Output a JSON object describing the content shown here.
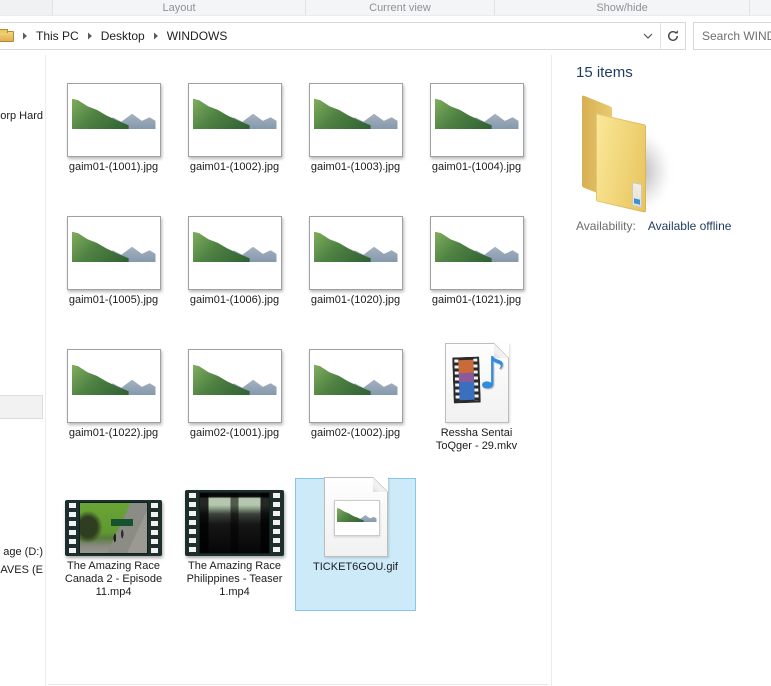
{
  "ribbon": {
    "groups": [
      {
        "label": "Layout"
      },
      {
        "label": "Current view"
      },
      {
        "label": "Show/hide"
      }
    ]
  },
  "address_bar": {
    "breadcrumb": [
      {
        "label": "This PC"
      },
      {
        "label": "Desktop"
      },
      {
        "label": "WINDOWS"
      }
    ],
    "search_placeholder": "Search WIND"
  },
  "sidebar": {
    "items": [
      {
        "label": "orp Hard"
      },
      {
        "label": "age (D:)"
      },
      {
        "label": "SAVES (E"
      }
    ]
  },
  "files": [
    {
      "name": "gaim01-(1001).jpg",
      "icon": "image",
      "selected": false
    },
    {
      "name": "gaim01-(1002).jpg",
      "icon": "image",
      "selected": false
    },
    {
      "name": "gaim01-(1003).jpg",
      "icon": "image",
      "selected": false
    },
    {
      "name": "gaim01-(1004).jpg",
      "icon": "image",
      "selected": false
    },
    {
      "name": "gaim01-(1005).jpg",
      "icon": "image",
      "selected": false
    },
    {
      "name": "gaim01-(1006).jpg",
      "icon": "image",
      "selected": false
    },
    {
      "name": "gaim01-(1020).jpg",
      "icon": "image",
      "selected": false
    },
    {
      "name": "gaim01-(1021).jpg",
      "icon": "image",
      "selected": false
    },
    {
      "name": "gaim01-(1022).jpg",
      "icon": "image",
      "selected": false
    },
    {
      "name": "gaim02-(1001).jpg",
      "icon": "image",
      "selected": false
    },
    {
      "name": "gaim02-(1002).jpg",
      "icon": "image",
      "selected": false
    },
    {
      "name": "Ressha Sentai ToQger - 29.mkv",
      "icon": "media-note",
      "selected": false
    },
    {
      "name": "The Amazing Race Canada 2 - Episode 11.mp4",
      "icon": "film-green",
      "selected": false
    },
    {
      "name": "The Amazing Race Philippines - Teaser 1.mp4",
      "icon": "film-dark",
      "selected": false
    },
    {
      "name": "TICKET6GOU.gif",
      "icon": "gif-page",
      "selected": true
    }
  ],
  "details_pane": {
    "item_count": "15 items",
    "availability_label": "Availability:",
    "availability_value": "Available offline"
  },
  "colors": {
    "selection_fill": "#cdeaf9",
    "selection_border": "#86c6ed",
    "accent_text": "#1e3c5f",
    "ribbon_caption": "#8f9296",
    "folder_yellow": "#f2d87e"
  }
}
